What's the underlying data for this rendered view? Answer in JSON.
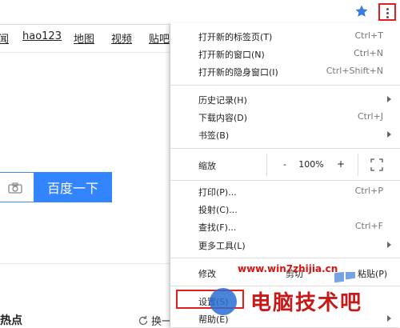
{
  "nav": {
    "links": [
      "闻",
      "hao123",
      "地图",
      "视频",
      "贴吧"
    ]
  },
  "search": {
    "button_label": "百度一下"
  },
  "hot": {
    "title": "热点",
    "swap_label": "换一"
  },
  "menu": {
    "new_tab": {
      "label": "打开新的标签页(T)",
      "shortcut": "Ctrl+T"
    },
    "new_window": {
      "label": "打开新的窗口(N)",
      "shortcut": "Ctrl+N"
    },
    "incognito": {
      "label": "打开新的隐身窗口(I)",
      "shortcut": "Ctrl+Shift+N"
    },
    "history": {
      "label": "历史记录(H)"
    },
    "downloads": {
      "label": "下载内容(D)",
      "shortcut": "Ctrl+J"
    },
    "bookmarks": {
      "label": "书签(B)"
    },
    "zoom": {
      "label": "缩放",
      "minus": "-",
      "value": "100%",
      "plus": "+"
    },
    "print": {
      "label": "打印(P)...",
      "shortcut": "Ctrl+P"
    },
    "cast": {
      "label": "投射(C)..."
    },
    "find": {
      "label": "查找(F)...",
      "shortcut": "Ctrl+F"
    },
    "more_tools": {
      "label": "更多工具(L)"
    },
    "edit": {
      "label": "修改",
      "cut": "剪切",
      "paste": "粘贴(P)"
    },
    "settings": {
      "label": "设置(S)"
    },
    "help": {
      "label": "帮助(E)"
    }
  },
  "watermark": {
    "url": "www.win7zhijia.cn",
    "text": "电脑技术吧"
  },
  "colors": {
    "accent": "#3385ff",
    "highlight_border": "#e02020",
    "star": "#3a7be0"
  }
}
